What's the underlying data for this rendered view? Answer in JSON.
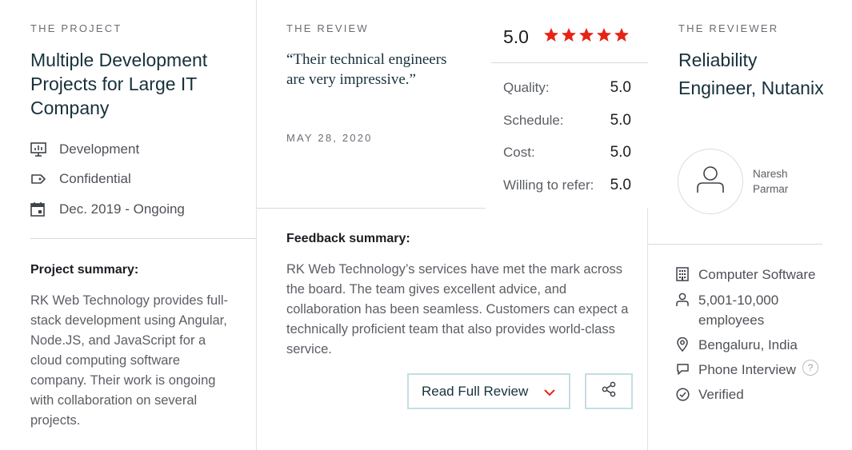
{
  "project": {
    "eyebrow": "THE PROJECT",
    "title": "Multiple Development Projects for Large IT Company",
    "meta": [
      {
        "icon": "monitor-chart-icon",
        "label": "Development"
      },
      {
        "icon": "price-tag-icon",
        "label": "Confidential"
      },
      {
        "icon": "calendar-icon",
        "label": "Dec. 2019 - Ongoing"
      }
    ],
    "summary_heading": "Project summary:",
    "summary_text": "RK Web Technology provides full-stack development using Angular, Node.JS, and JavaScript for a cloud computing software company. Their work is ongoing with collaboration on several projects."
  },
  "review": {
    "eyebrow": "THE REVIEW",
    "quote": "“Their technical engineers are very impressive.”",
    "date": "MAY 28, 2020",
    "overall_score": "5.0",
    "stars": 5,
    "star_color": "#e62415",
    "ratings": [
      {
        "label": "Quality:",
        "value": "5.0"
      },
      {
        "label": "Schedule:",
        "value": "5.0"
      },
      {
        "label": "Cost:",
        "value": "5.0"
      },
      {
        "label": "Willing to refer:",
        "value": "5.0"
      }
    ],
    "feedback_heading": "Feedback summary:",
    "feedback_text": "RK Web Technology’s services have met the mark across the board. The team gives excellent advice, and collaboration has been seamless. Customers can expect a technically proficient team that also provides world-class service.",
    "read_full_label": "Read Full Review",
    "accent_color": "#e62415",
    "button_border_color": "#c6dde4"
  },
  "reviewer": {
    "eyebrow": "THE REVIEWER",
    "title": "Reliability Engineer, Nutanix",
    "name": "Naresh Parmar",
    "details": [
      {
        "icon": "building-icon",
        "label": "Computer Software"
      },
      {
        "icon": "user-icon",
        "label": "5,001-10,000 employees"
      },
      {
        "icon": "location-pin-icon",
        "label": "Bengaluru, India"
      },
      {
        "icon": "chat-bubble-icon",
        "label": "Phone Interview",
        "help": "?"
      },
      {
        "icon": "check-circle-icon",
        "label": "Verified"
      }
    ]
  }
}
